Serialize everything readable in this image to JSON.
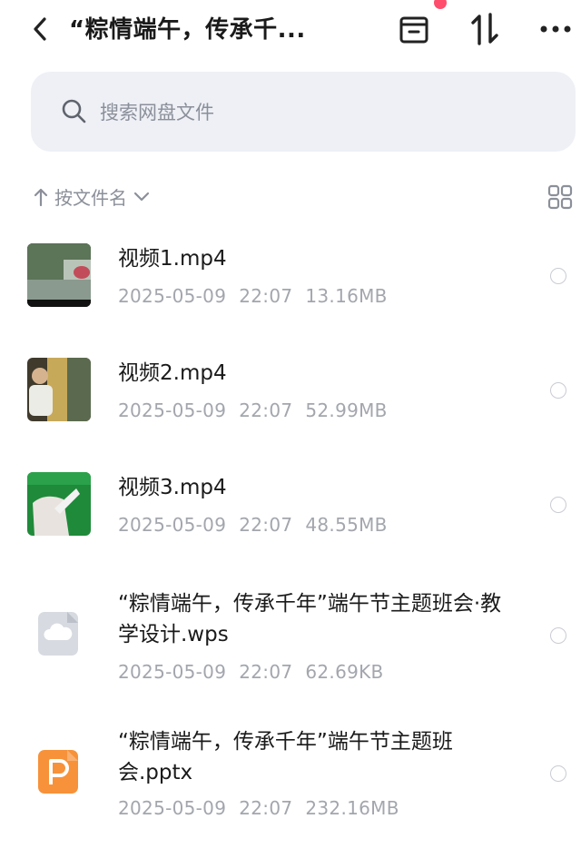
{
  "header": {
    "title": "“粽情端午，传承千...",
    "back_icon": "chevron-left-icon",
    "actions": [
      "box-icon",
      "sort-arrows-icon",
      "more-icon"
    ]
  },
  "search": {
    "placeholder": "搜索网盘文件"
  },
  "sort": {
    "label": "按文件名",
    "view_icon": "grid-view-icon"
  },
  "files": [
    {
      "name": "视频1.mp4",
      "date": "2025-05-09",
      "time": "22:07",
      "size": "13.16MB",
      "thumb": "video-thumb-street"
    },
    {
      "name": "视频2.mp4",
      "date": "2025-05-09",
      "time": "22:07",
      "size": "52.99MB",
      "thumb": "video-thumb-person"
    },
    {
      "name": "视频3.mp4",
      "date": "2025-05-09",
      "time": "22:07",
      "size": "48.55MB",
      "thumb": "video-thumb-green"
    },
    {
      "name": "“粽情端午，传承千年”端午节主题班会·教学设计.wps",
      "date": "2025-05-09",
      "time": "22:07",
      "size": "62.69KB",
      "thumb": "cloud-doc-icon"
    },
    {
      "name": "“粽情端午，传承千年”端午节主题班会.pptx",
      "date": "2025-05-09",
      "time": "22:07",
      "size": "232.16MB",
      "thumb": "ppt-icon"
    }
  ],
  "colors": {
    "accent_red": "#ff4d6d",
    "ppt_orange": "#f7923a",
    "search_bg": "#eef0f6",
    "meta_gray": "#a3a6ad"
  }
}
